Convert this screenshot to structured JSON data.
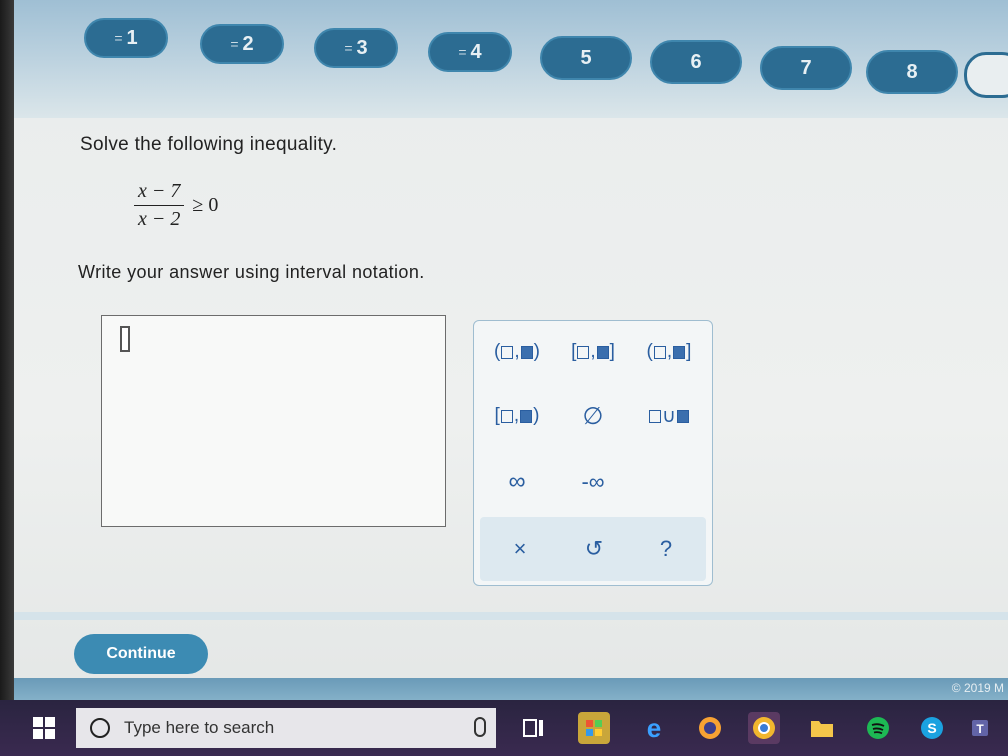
{
  "nav": {
    "items": [
      {
        "label": "1",
        "done": true
      },
      {
        "label": "2",
        "done": true
      },
      {
        "label": "3",
        "done": true
      },
      {
        "label": "4",
        "done": true
      },
      {
        "label": "5",
        "done": false
      },
      {
        "label": "6",
        "done": false
      },
      {
        "label": "7",
        "done": false
      },
      {
        "label": "8",
        "done": false
      }
    ],
    "done_marker": "="
  },
  "question": {
    "prompt": "Solve the following inequality.",
    "numerator": "x − 7",
    "denominator": "x − 2",
    "relation": "≥ 0",
    "instruction": "Write your answer using interval notation."
  },
  "keypad": {
    "infinity": "∞",
    "neg_infinity": "-∞",
    "empty_set": "∅",
    "clear": "×",
    "undo": "↺",
    "help": "?"
  },
  "continue_label": "Continue",
  "copyright": "© 2019 M",
  "taskbar": {
    "search_placeholder": "Type here to search"
  },
  "colors": {
    "accent": "#2c6c92",
    "button": "#3c8bb3",
    "keypad_text": "#2a5ea0"
  }
}
